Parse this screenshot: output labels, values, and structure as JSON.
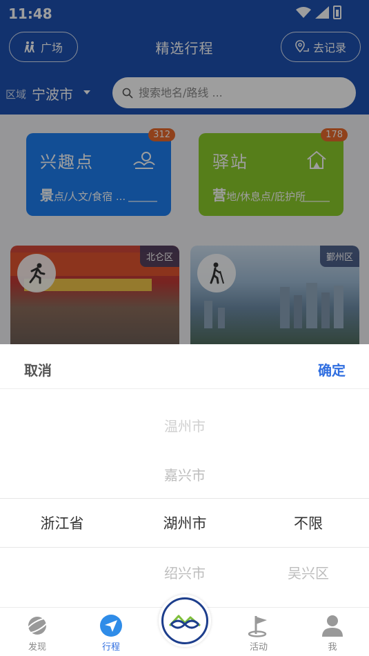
{
  "status": {
    "time": "11:48"
  },
  "header": {
    "title": "精选行程",
    "left_button": "广场",
    "right_button": "去记录",
    "region_label": "区域",
    "region_value": "宁波市",
    "search_placeholder": "搜索地名/路线 ..."
  },
  "categories": [
    {
      "title": "兴趣点",
      "sub_bold": "景",
      "sub_rest": "点/人文/食宿 ...",
      "count": "312",
      "color": "#1e7ff0"
    },
    {
      "title": "驿站",
      "sub_bold": "营",
      "sub_rest": "地/休息点/庇护所",
      "count": "178",
      "color": "#8ccc2a"
    }
  ],
  "routes": [
    {
      "district": "北仑区",
      "icon": "runner-icon"
    },
    {
      "district": "鄞州区",
      "icon": "hiker-icon"
    }
  ],
  "picker": {
    "cancel": "取消",
    "confirm": "确定",
    "col1": {
      "selected": "浙江省"
    },
    "col2": {
      "above2": "温州市",
      "above1": "嘉兴市",
      "selected": "湖州市",
      "below1": "绍兴市"
    },
    "col3": {
      "selected": "不限",
      "below1": "吴兴区"
    }
  },
  "tabbar": {
    "items": [
      {
        "label": "发现",
        "icon": "planet-icon"
      },
      {
        "label": "行程",
        "icon": "navigation-arrow-icon",
        "active": true
      },
      {
        "label": "活动",
        "icon": "flag-icon"
      },
      {
        "label": "我",
        "icon": "user-icon"
      }
    ]
  },
  "colors": {
    "primary": "#1d52b2",
    "accent": "#2f6ee0",
    "badge": "#e8692c"
  }
}
